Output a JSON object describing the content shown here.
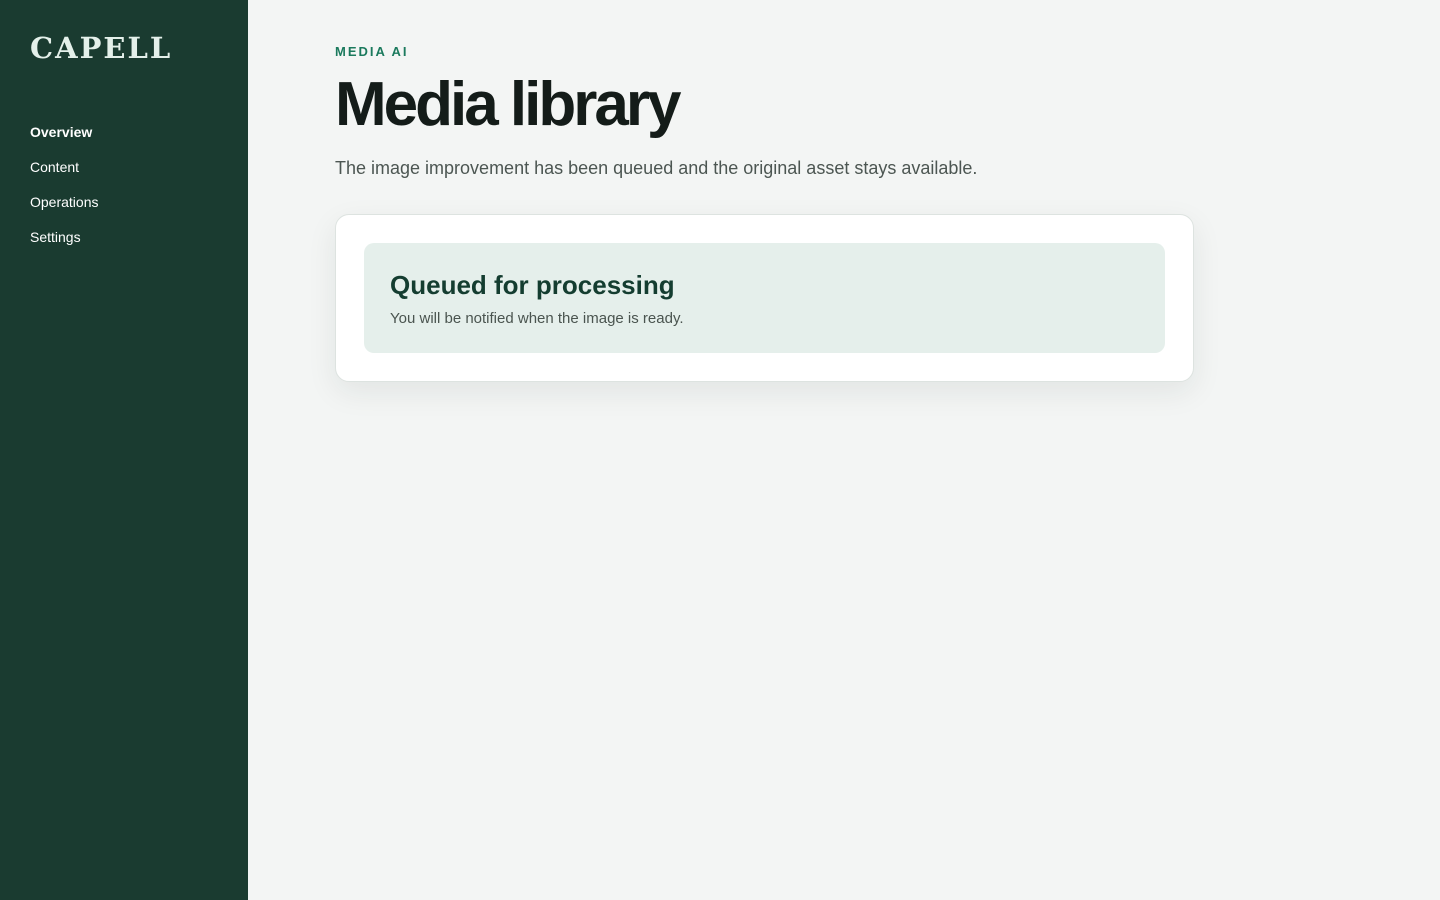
{
  "brand": {
    "logo_text": "CAPELL"
  },
  "sidebar": {
    "items": [
      {
        "label": "Overview",
        "active": true
      },
      {
        "label": "Content",
        "active": false
      },
      {
        "label": "Operations",
        "active": false
      },
      {
        "label": "Settings",
        "active": false
      }
    ]
  },
  "header": {
    "eyebrow": "MEDIA AI",
    "title": "Media library",
    "subtitle": "The image improvement has been queued and the original asset stays available."
  },
  "notice": {
    "title": "Queued for processing",
    "text": "You will be notified when the image is ready."
  },
  "colors": {
    "sidebar_bg": "#1a3b30",
    "accent": "#1b7a5d",
    "notice_bg": "#e5efeb",
    "page_bg": "#f3f5f4"
  }
}
